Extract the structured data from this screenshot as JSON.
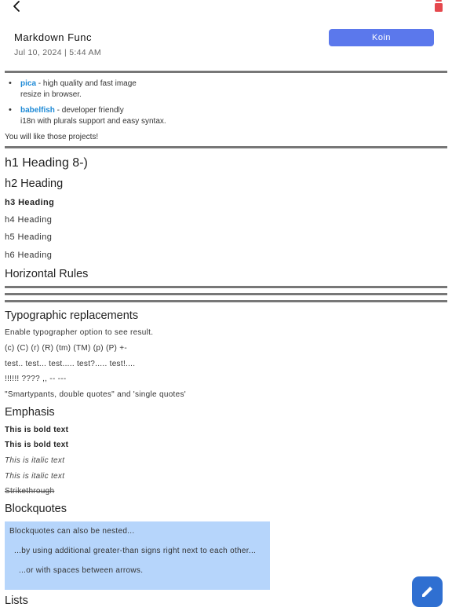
{
  "header": {
    "title": "Markdown Func",
    "date": "Jul 10, 2024 | 5:44 AM",
    "koin_button": "Koin"
  },
  "icons": {
    "back": "chevron-left-icon",
    "delete": "trash-icon",
    "edit": "pencil-icon"
  },
  "colors": {
    "accent": "#5b78ec",
    "trash": "#e5484d",
    "link": "#1e8ad6",
    "quote_bg": "#b6d5fb",
    "fab": "#2f6fd1"
  },
  "content": {
    "list": [
      {
        "link": "pica",
        "text": " - high quality and fast image",
        "cont": "resize in browser."
      },
      {
        "link": "babelfish",
        "text": " - developer friendly",
        "cont": "i18n with plurals support and easy syntax."
      }
    ],
    "after_list": "You will like those projects!",
    "h1": "h1 Heading 8-)",
    "h2": "h2 Heading",
    "h3": "h3 Heading",
    "h4": "h4 Heading",
    "h5": "h5 Heading",
    "h6": "h6 Heading",
    "hr_title": "Horizontal Rules",
    "typo_title": "Typographic replacements",
    "typo_lines": [
      "Enable typographer option to see result.",
      "(c) (C) (r) (R) (tm) (TM) (p) (P) +-",
      "test.. test... test..... test?..... test!....",
      "!!!!!! ???? ,,  -- ---",
      "\"Smartypants, double quotes\" and 'single quotes'"
    ],
    "emphasis_title": "Emphasis",
    "bold1": "This is bold text",
    "bold2": "This is bold text",
    "ital1": "This is italic text",
    "ital2": "This is italic text",
    "strike": "Strikethrough",
    "block_title": "Blockquotes",
    "quotes": [
      "Blockquotes can also be nested...",
      "...by using additional greater-than signs right next to each other...",
      "...or with spaces between arrows."
    ],
    "lists_title": "Lists"
  }
}
